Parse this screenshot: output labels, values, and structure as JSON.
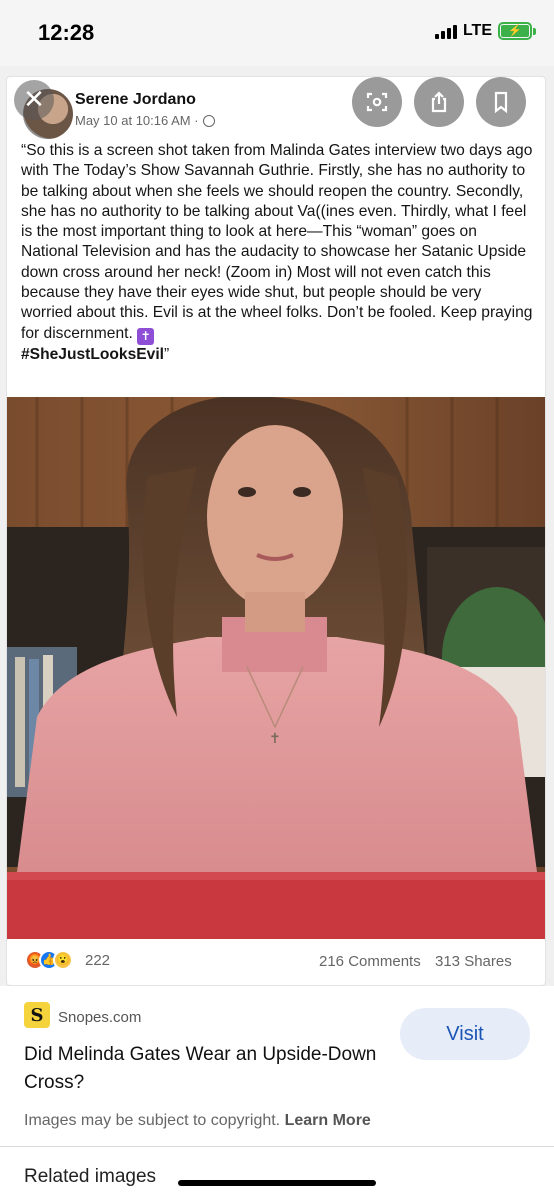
{
  "status_bar": {
    "time": "12:28",
    "network": "LTE",
    "icons": [
      "signal-icon",
      "battery-charging-icon"
    ]
  },
  "post": {
    "author": "Serene Jordano",
    "timestamp": "May 10 at 10:16 AM ·",
    "text": "“So this is a screen shot taken from Malinda Gates interview two days ago with The Today’s Show Savannah Guthrie. Firstly, she has no authority to be talking about when she feels we should reopen the country. Secondly, she has no authority to be talking about Va((ines even. Thirdly, what I feel is the most important thing to look at here—This “woman” goes on National Television and has the audacity to showcase her Satanic Upside down cross around her neck! (Zoom in) Most will not even catch this because they have their eyes wide shut, but people should be very worried about this. Evil is at the wheel folks. Don’t be fooled. Keep praying for discernment.",
    "hashtag": "#SheJustLooksEvil",
    "closing_quote": "”",
    "reaction_count": "222",
    "comments": "216 Comments",
    "shares": "313 Shares",
    "icons": [
      "close-icon",
      "lens-icon",
      "share-icon",
      "bookmark-icon",
      "globe-icon",
      "cross-emoji-icon"
    ]
  },
  "result": {
    "site": "Snopes.com",
    "title": "Did Melinda Gates Wear an Upside-Down Cross?",
    "visit_label": "Visit",
    "copyright_text": "Images may be subject to copyright.",
    "learn_more": "Learn More",
    "related_label": "Related images"
  },
  "colors": {
    "visit_bg": "#e6ecf8",
    "visit_text": "#1a55b6",
    "snopes_logo": "#f5d33d",
    "battery": "#3cb14a"
  }
}
